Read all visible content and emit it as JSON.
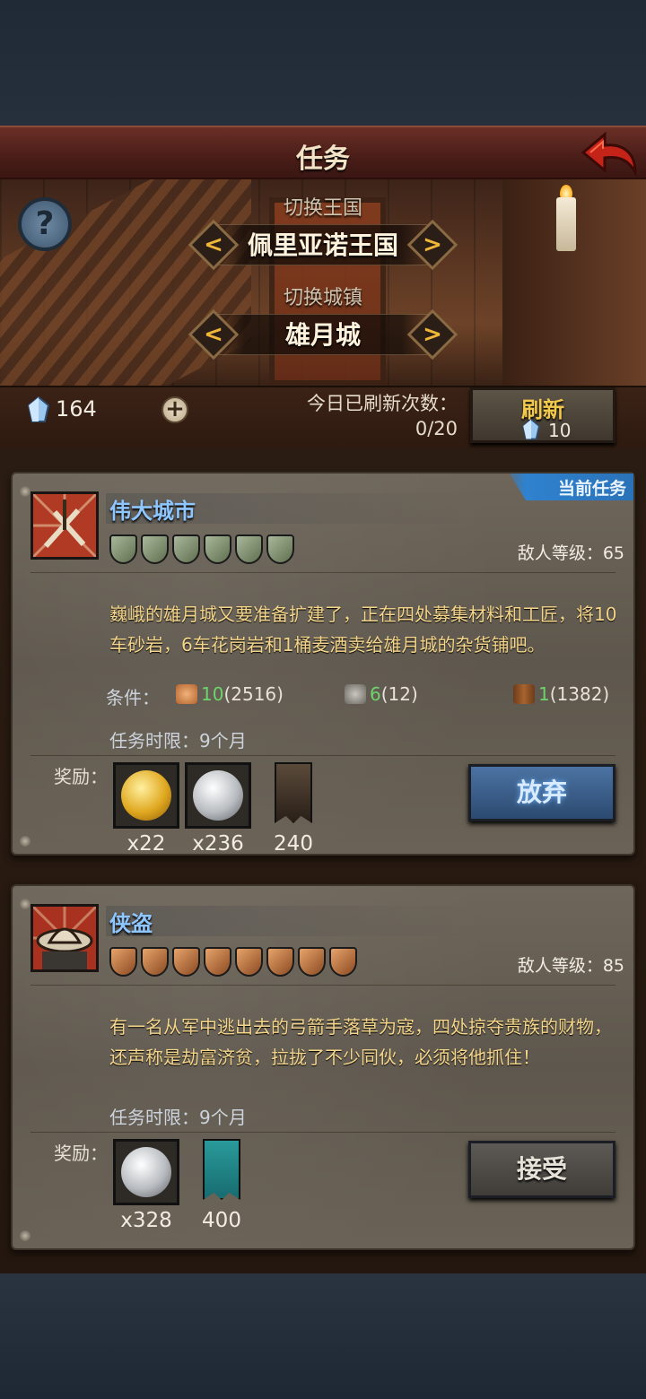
{
  "header": {
    "title": "任务"
  },
  "selector": {
    "kingdom_label": "切换王国",
    "kingdom_value": "佩里亚诺王国",
    "town_label": "切换城镇",
    "town_value": "雄月城",
    "prev_symbol": "<",
    "next_symbol": ">"
  },
  "help": {
    "symbol": "?"
  },
  "resources": {
    "crystal_count": "164",
    "add_symbol": "+",
    "refresh_label": "今日已刷新次数：",
    "refresh_count": "0/20",
    "refresh_button": "刷新",
    "refresh_cost": "10"
  },
  "quests": [
    {
      "tag": "当前任务",
      "name": "伟大城市",
      "difficulty": 6,
      "enemy_level": "敌人等级：65",
      "description": "巍峨的雄月城又要准备扩建了，正在四处募集材料和工匠，将10车砂岩，6车花岗岩和1桶麦酒卖给雄月城的杂货铺吧。",
      "conditions_label": "条件：",
      "conditions": [
        {
          "icon": "sandstone-icon",
          "have": "10",
          "stock": "(2516)"
        },
        {
          "icon": "granite-icon",
          "have": "6",
          "stock": "(12)"
        },
        {
          "icon": "ale-barrel-icon",
          "have": "1",
          "stock": "(1382)"
        }
      ],
      "time_limit": "任务时限：9个月",
      "reward_label": "奖励：",
      "rewards": [
        {
          "icon": "gold-coin-icon",
          "qty": "x22"
        },
        {
          "icon": "silver-coin-icon",
          "qty": "x236"
        },
        {
          "icon": "dark-banner-icon",
          "qty": "240"
        }
      ],
      "action": "放弃"
    },
    {
      "name": "侠盗",
      "difficulty": 8,
      "enemy_level": "敌人等级：85",
      "description": "有一名从军中逃出去的弓箭手落草为寇，四处掠夺贵族的财物，还声称是劫富济贫，拉拢了不少同伙，必须将他抓住！",
      "time_limit": "任务时限：9个月",
      "reward_label": "奖励：",
      "rewards": [
        {
          "icon": "silver-coin-icon",
          "qty": "x328"
        },
        {
          "icon": "teal-banner-icon",
          "qty": "400"
        }
      ],
      "action": "接受"
    }
  ],
  "colors": {
    "accent_blue": "#2f82cf",
    "title_blue": "#8ec6ff",
    "desc_gold": "#f4d58a",
    "count_green": "#6fd36c"
  }
}
